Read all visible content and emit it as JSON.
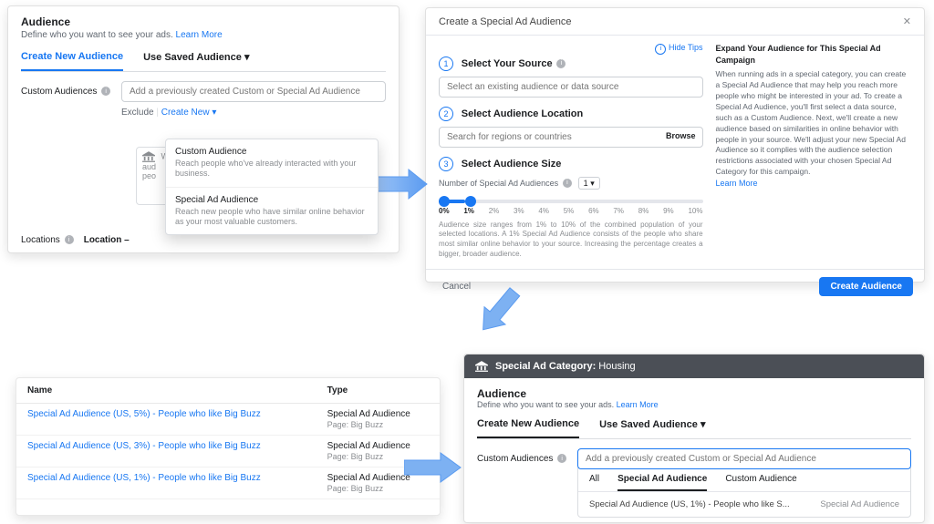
{
  "panelA": {
    "title": "Audience",
    "subtitle": "Define who you want to see your ads.",
    "learn": "Learn More",
    "tab_create": "Create New Audience",
    "tab_saved": "Use Saved Audience",
    "custom_label": "Custom Audiences",
    "placeholder": "Add a previously created Custom or Special Ad Audience",
    "exclude": "Exclude",
    "create_new": "Create New",
    "wh_line1": "Wh",
    "wh_line2": "aud",
    "wh_line3": "peo",
    "dd": {
      "a_title": "Custom Audience",
      "a_sub": "Reach people who've already interacted with your business.",
      "b_title": "Special Ad Audience",
      "b_sub": "Reach new people who have similar online behavior as your most valuable customers."
    },
    "locations_label": "Locations",
    "location_value": "Location –"
  },
  "panelB": {
    "title": "Create a Special Ad Audience",
    "hide": "Hide Tips",
    "step1": "Select Your Source",
    "step1_ph": "Select an existing audience or data source",
    "step2": "Select Audience Location",
    "step2_ph": "Search for regions or countries",
    "browse": "Browse",
    "step3": "Select Audience Size",
    "size_label": "Number of Special Ad Audiences",
    "size_value": "1",
    "ticks": [
      "0%",
      "1%",
      "2%",
      "3%",
      "4%",
      "5%",
      "6%",
      "7%",
      "8%",
      "9%",
      "10%"
    ],
    "size_help": "Audience size ranges from 1% to 10% of the combined population of your selected locations. A 1% Special Ad Audience consists of the people who share most similar online behavior to your source. Increasing the percentage creates a bigger, broader audience.",
    "side_title": "Expand Your Audience for This Special Ad Campaign",
    "side_body": "When running ads in a special category, you can create a Special Ad Audience that may help you reach more people who might be interested in your ad. To create a Special Ad Audience, you'll first select a data source, such as a Custom Audience. Next, we'll create a new audience based on similarities in online behavior with people in your source. We'll adjust your new Special Ad Audience so it complies with the audience selection restrictions associated with your chosen Special Ad Category for this campaign.",
    "learn": "Learn More",
    "cancel": "Cancel",
    "create": "Create Audience"
  },
  "panelC": {
    "col_name": "Name",
    "col_type": "Type",
    "rows": [
      {
        "name": "Special Ad Audience (US, 5%) - People who like Big Buzz",
        "type": "Special Ad Audience",
        "sub": "Page: Big Buzz"
      },
      {
        "name": "Special Ad Audience (US, 3%) - People who like Big Buzz",
        "type": "Special Ad Audience",
        "sub": "Page: Big Buzz"
      },
      {
        "name": "Special Ad Audience (US, 1%) - People who like Big Buzz",
        "type": "Special Ad Audience",
        "sub": "Page: Big Buzz"
      }
    ]
  },
  "panelD": {
    "bar_label": "Special Ad Category:",
    "bar_value": "Housing",
    "title": "Audience",
    "subtitle": "Define who you want to see your ads.",
    "learn": "Learn More",
    "tab_create": "Create New Audience",
    "tab_saved": "Use Saved Audience",
    "custom_label": "Custom Audiences",
    "placeholder": "Add a previously created Custom or Special Ad Audience",
    "dd_tabs": {
      "all": "All",
      "special": "Special Ad Audience",
      "custom": "Custom Audience"
    },
    "dd_opt_name": "Special Ad Audience (US, 1%) - People who like S...",
    "dd_opt_type": "Special Ad Audience"
  }
}
